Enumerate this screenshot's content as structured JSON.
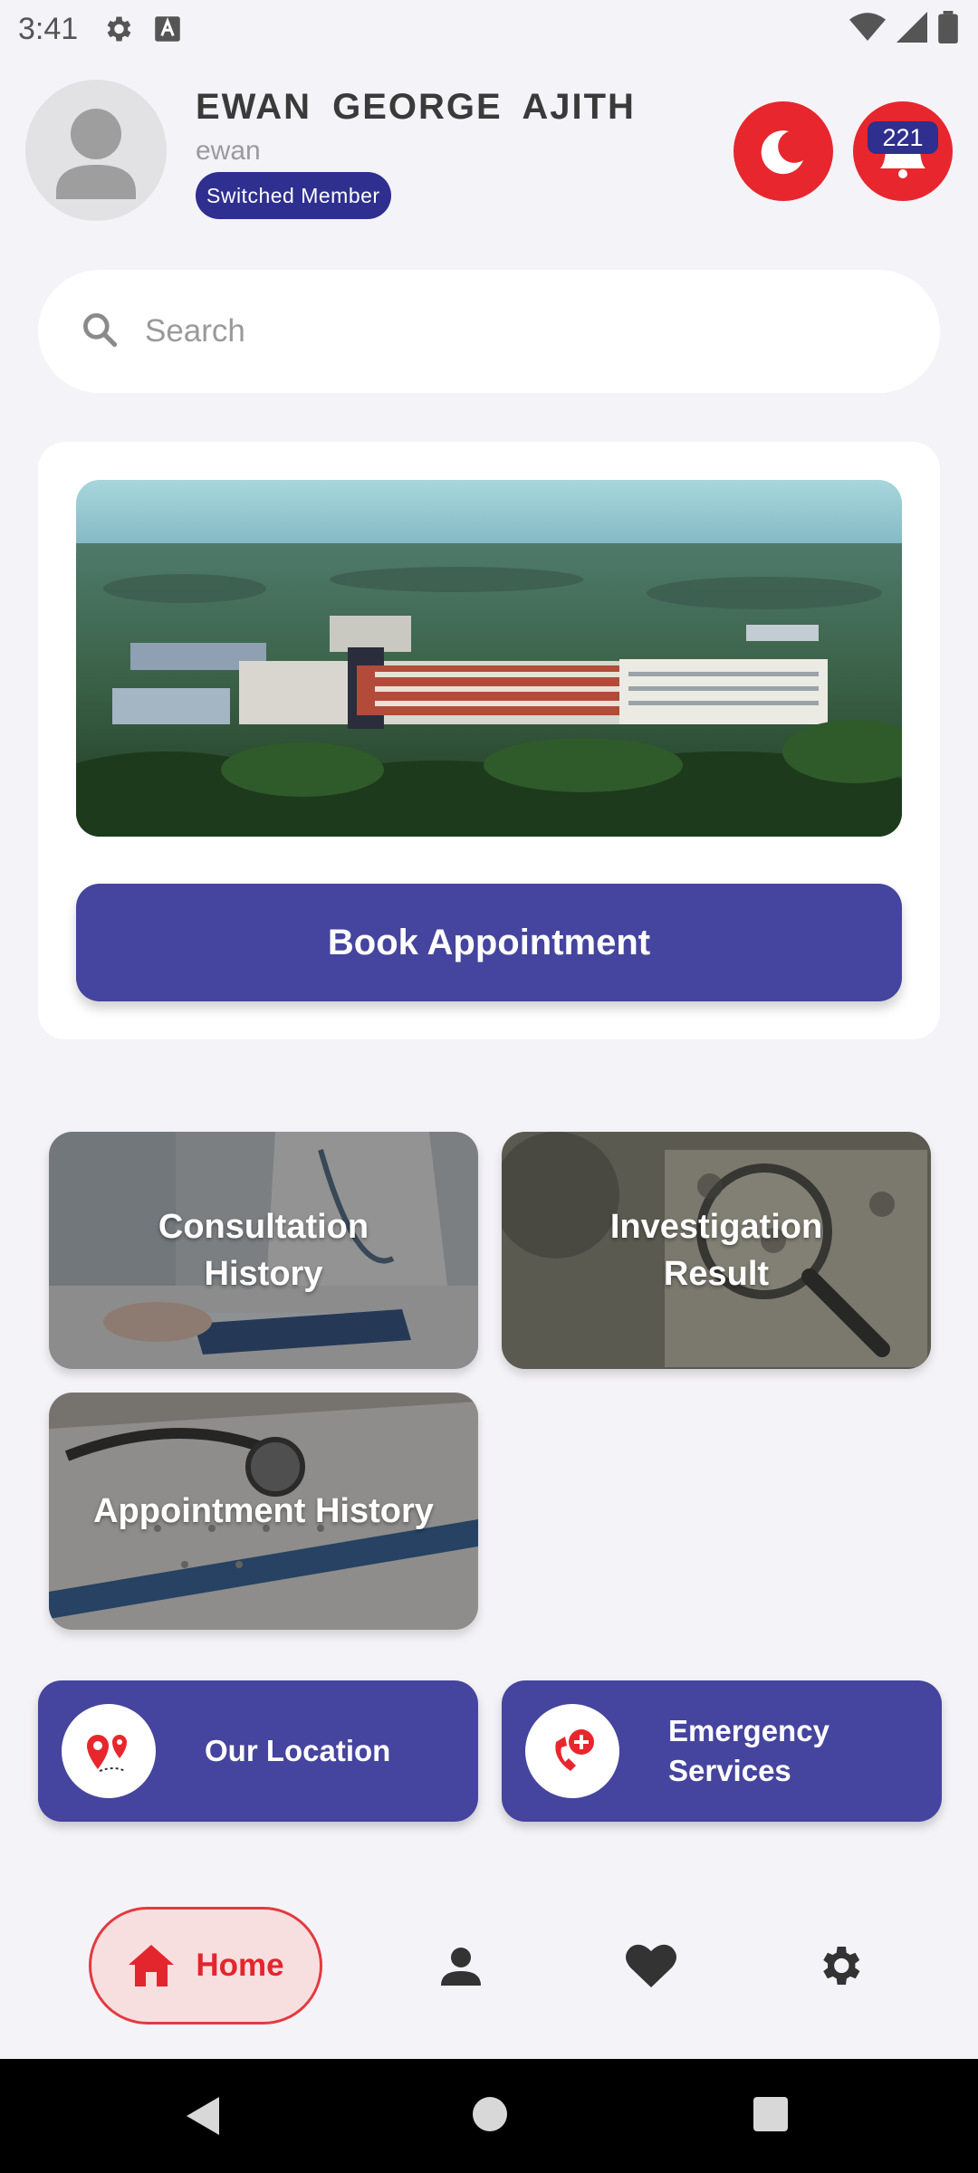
{
  "status_bar": {
    "time": "3:41",
    "icons": [
      "gear-icon",
      "font-icon",
      "wifi-icon",
      "signal-icon",
      "battery-icon"
    ]
  },
  "header": {
    "name": "EWAN  GEORGE  AJITH",
    "username": "ewan",
    "badge": "Switched Member",
    "notification_count": "221"
  },
  "search": {
    "placeholder": "Search"
  },
  "banner": {
    "book_button": "Book Appointment"
  },
  "tiles": [
    {
      "label": "Consultation History"
    },
    {
      "label": "Investigation Result"
    },
    {
      "label": "Appointment History"
    }
  ],
  "actions": {
    "location": "Our Location",
    "emergency_line1": "Emergency",
    "emergency_line2": "Services"
  },
  "bottom_nav": {
    "home": "Home",
    "items": [
      "home-icon",
      "profile-icon",
      "heart-icon",
      "settings-icon"
    ]
  },
  "colors": {
    "primary": "#45449e",
    "accent_red": "#e8262d",
    "badge": "#2e2f8f",
    "background": "#f4f3f8"
  }
}
